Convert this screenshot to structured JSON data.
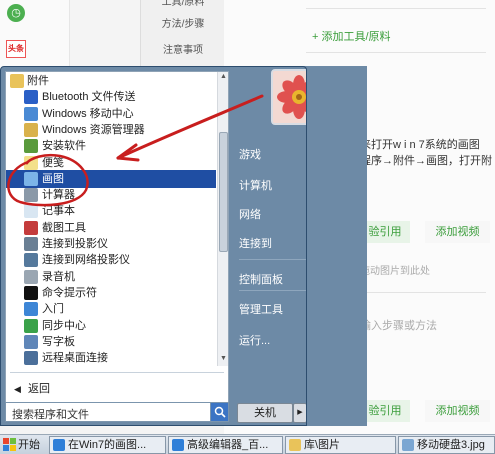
{
  "background_page": {
    "steps_tabs": [
      "工具/原料",
      "方法/步骤",
      "注意事项"
    ],
    "add_tool_label": "+ 添加工具/原料",
    "intro_line1": "来打开w i n 7系统的画图",
    "intro_line2": "程序→附件→画图，打开附",
    "quote_button": "验引用",
    "add_video_button": "添加视频",
    "drag_hint": "拖动图片到此处",
    "input_hint": "输入步骤或方法",
    "quote_button_2": "验引用",
    "add_video_button_2": "添加视频",
    "news_badge": "头条"
  },
  "start_menu": {
    "programs": [
      {
        "label": "附件",
        "icon": "folder-icon",
        "indent": 1
      },
      {
        "label": "Bluetooth 文件传送",
        "icon": "bluetooth-icon",
        "indent": 2
      },
      {
        "label": "Windows 移动中心",
        "icon": "mobility-center-icon",
        "indent": 2
      },
      {
        "label": "Windows 资源管理器",
        "icon": "explorer-icon",
        "indent": 2
      },
      {
        "label": "安装软件",
        "icon": "install-icon",
        "indent": 2
      },
      {
        "label": "便笺",
        "icon": "sticky-notes-icon",
        "indent": 2
      },
      {
        "label": "画图",
        "icon": "paint-icon",
        "indent": 2,
        "selected": true
      },
      {
        "label": "计算器",
        "icon": "calculator-icon",
        "indent": 2
      },
      {
        "label": "记事本",
        "icon": "notepad-icon",
        "indent": 2
      },
      {
        "label": "截图工具",
        "icon": "snipping-tool-icon",
        "indent": 2
      },
      {
        "label": "连接到投影仪",
        "icon": "projector-icon",
        "indent": 2
      },
      {
        "label": "连接到网络投影仪",
        "icon": "network-projector-icon",
        "indent": 2
      },
      {
        "label": "录音机",
        "icon": "sound-recorder-icon",
        "indent": 2
      },
      {
        "label": "命令提示符",
        "icon": "cmd-icon",
        "indent": 2
      },
      {
        "label": "入门",
        "icon": "getting-started-icon",
        "indent": 2
      },
      {
        "label": "同步中心",
        "icon": "sync-center-icon",
        "indent": 2
      },
      {
        "label": "写字板",
        "icon": "wordpad-icon",
        "indent": 2
      },
      {
        "label": "远程桌面连接",
        "icon": "remote-desktop-icon",
        "indent": 2
      }
    ],
    "back_label": "返回",
    "search_placeholder": "搜索程序和文件",
    "right_items": [
      {
        "label": "游戏",
        "submenu": true
      },
      {
        "label": "计算机",
        "submenu": true
      },
      {
        "label": "网络",
        "submenu": false
      },
      {
        "label": "连接到",
        "submenu": false
      },
      {
        "label": "控制面板",
        "submenu": true
      },
      {
        "label": "管理工具",
        "submenu": true
      },
      {
        "label": "运行...",
        "submenu": false
      }
    ],
    "shutdown_label": "关机"
  },
  "taskbar": {
    "start_label": "开始",
    "tasks": [
      {
        "label": "在Win7的画图...",
        "icon": "ie-icon"
      },
      {
        "label": "高级编辑器_百...",
        "icon": "ie-icon"
      },
      {
        "label": "库\\图片",
        "icon": "folder-icon"
      },
      {
        "label": "移动硬盘3.jpg",
        "icon": "image-file-icon"
      }
    ]
  },
  "colors": {
    "selection": "#1f4ea3",
    "annotation": "#c81e1e",
    "menu_right_pane": "#6d8aa6"
  }
}
